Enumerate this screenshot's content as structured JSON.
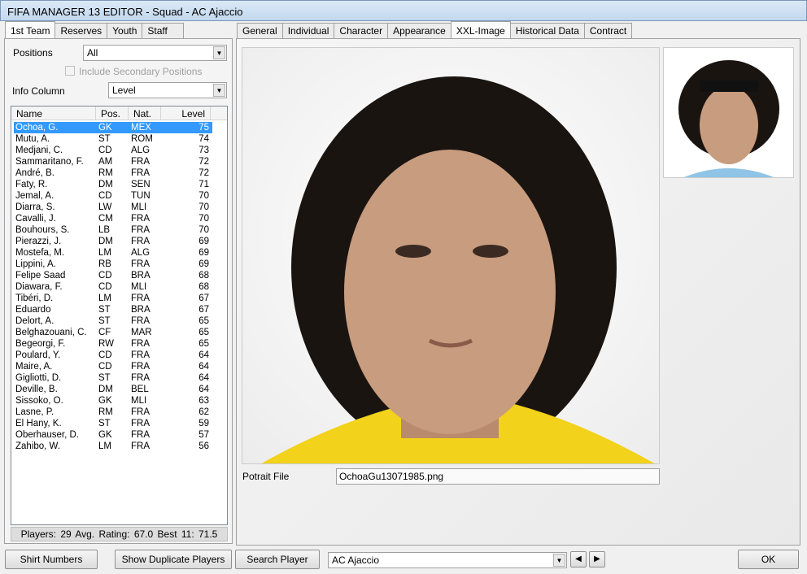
{
  "window": {
    "title": "FIFA MANAGER 13 EDITOR - Squad - AC Ajaccio"
  },
  "left_tabs": [
    "1st Team",
    "Reserves",
    "Youth",
    "Staff"
  ],
  "filters": {
    "positions_label": "Positions",
    "positions_value": "All",
    "secondary_label": "Include Secondary Positions",
    "info_label": "Info Column",
    "info_value": "Level"
  },
  "list": {
    "headers": [
      "Name",
      "Pos.",
      "Nat.",
      "Level"
    ],
    "rows": [
      [
        "Ochoa, G.",
        "GK",
        "MEX",
        "75"
      ],
      [
        "Mutu, A.",
        "ST",
        "ROM",
        "74"
      ],
      [
        "Medjani, C.",
        "CD",
        "ALG",
        "73"
      ],
      [
        "Sammaritano, F.",
        "AM",
        "FRA",
        "72"
      ],
      [
        "André, B.",
        "RM",
        "FRA",
        "72"
      ],
      [
        "Faty, R.",
        "DM",
        "SEN",
        "71"
      ],
      [
        "Jemal, A.",
        "CD",
        "TUN",
        "70"
      ],
      [
        "Diarra, S.",
        "LW",
        "MLI",
        "70"
      ],
      [
        "Cavalli, J.",
        "CM",
        "FRA",
        "70"
      ],
      [
        "Bouhours, S.",
        "LB",
        "FRA",
        "70"
      ],
      [
        "Pierazzi, J.",
        "DM",
        "FRA",
        "69"
      ],
      [
        "Mostefa, M.",
        "LM",
        "ALG",
        "69"
      ],
      [
        "Lippini, A.",
        "RB",
        "FRA",
        "69"
      ],
      [
        "Felipe Saad",
        "CD",
        "BRA",
        "68"
      ],
      [
        "Diawara, F.",
        "CD",
        "MLI",
        "68"
      ],
      [
        "Tibéri, D.",
        "LM",
        "FRA",
        "67"
      ],
      [
        "Eduardo",
        "ST",
        "BRA",
        "67"
      ],
      [
        "Delort, A.",
        "ST",
        "FRA",
        "65"
      ],
      [
        "Belghazouani, C.",
        "CF",
        "MAR",
        "65"
      ],
      [
        "Begeorgi, F.",
        "RW",
        "FRA",
        "65"
      ],
      [
        "Poulard, Y.",
        "CD",
        "FRA",
        "64"
      ],
      [
        "Maire, A.",
        "CD",
        "FRA",
        "64"
      ],
      [
        "Gigliotti, D.",
        "ST",
        "FRA",
        "64"
      ],
      [
        "Deville, B.",
        "DM",
        "BEL",
        "64"
      ],
      [
        "Sissoko, O.",
        "GK",
        "MLI",
        "63"
      ],
      [
        "Lasne, P.",
        "RM",
        "FRA",
        "62"
      ],
      [
        "El Hany, K.",
        "ST",
        "FRA",
        "59"
      ],
      [
        "Oberhauser, D.",
        "GK",
        "FRA",
        "57"
      ],
      [
        "Zahibo, W.",
        "LM",
        "FRA",
        "56"
      ]
    ],
    "selected": 0
  },
  "status": "Players: 29   Avg. Rating: 67.0   Best 11: 71.5",
  "right_tabs": [
    "General",
    "Individual",
    "Character",
    "Appearance",
    "XXL-Image",
    "Historical Data",
    "Contract"
  ],
  "active_right_tab": 4,
  "portrait": {
    "label": "Potrait File",
    "value": "OchoaGu13071985.png"
  },
  "bottom": {
    "shirt": "Shirt Numbers",
    "dup": "Show Duplicate Players",
    "search": "Search Player",
    "team": "AC Ajaccio",
    "ok": "OK"
  },
  "colors": {
    "selection": "#3399ff",
    "shirt": "#f2d21a"
  }
}
